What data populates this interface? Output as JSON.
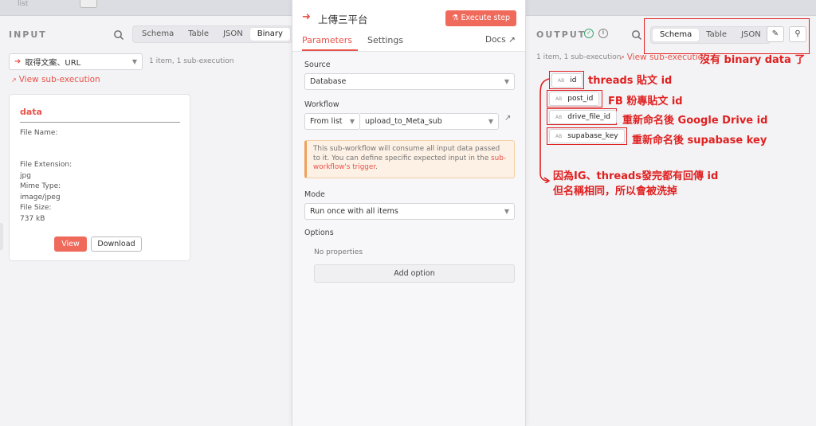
{
  "topbar": {
    "label": "list"
  },
  "input": {
    "title": "INPUT",
    "views": [
      "Schema",
      "Table",
      "JSON",
      "Binary"
    ],
    "active_view": "Binary",
    "node_select": "取得文案、URL",
    "meta": "1 item, 1 sub-execution",
    "sub_link": "View sub-execution",
    "card": {
      "title": "data",
      "file_name_label": "File Name:",
      "file_ext_label": "File Extension:",
      "file_ext_value": "jpg",
      "mime_label": "Mime Type:",
      "mime_value": "image/jpeg",
      "size_label": "File Size:",
      "size_value": "737 kB",
      "view_btn": "View",
      "download_btn": "Download"
    }
  },
  "node": {
    "title": "上傳三平台",
    "execute_btn": "Execute step",
    "tabs": {
      "parameters": "Parameters",
      "settings": "Settings",
      "docs": "Docs"
    },
    "source_label": "Source",
    "source_value": "Database",
    "workflow_label": "Workflow",
    "workflow_mode": "From list",
    "workflow_value": "upload_to_Meta_sub",
    "notice_text": "This sub-workflow will consume all input data passed to it. You can define specific expected input in the ",
    "notice_link": "sub-workflow's trigger",
    "notice_end": ".",
    "mode_label": "Mode",
    "mode_value": "Run once with all items",
    "options_label": "Options",
    "no_props": "No properties",
    "add_option": "Add option"
  },
  "output": {
    "title": "OUTPUT",
    "views": [
      "Schema",
      "Table",
      "JSON"
    ],
    "active_view": "Schema",
    "meta": "1 item, 1 sub-execution",
    "sub_link": "View sub-executio",
    "fields": [
      "id",
      "post_id",
      "drive_file_id",
      "supabase_key"
    ],
    "field_type": "AB"
  },
  "annotations": {
    "binary": "沒有 binary data 了",
    "id": "threads 貼文 id",
    "post_id": "FB 粉專貼文 id",
    "drive": "重新命名後 Google Drive id",
    "supabase": "重新命名後 supabase key",
    "note_line1": "因為IG、threads發完都有回傳 id",
    "note_line2": "但名稱相同，所以會被洗掉"
  },
  "colors": {
    "accent": "#e8534a",
    "annotation": "#e02020",
    "success": "#3ca66d"
  }
}
